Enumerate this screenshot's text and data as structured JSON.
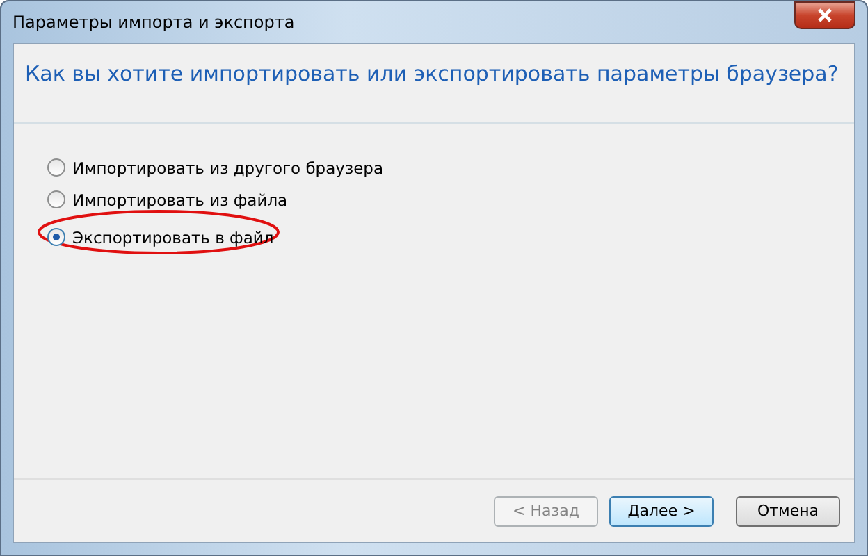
{
  "window": {
    "title": "Параметры импорта и экспорта"
  },
  "heading": "Как вы хотите импортировать или экспортировать параметры браузера?",
  "options": [
    {
      "label": "Импортировать из другого браузера",
      "selected": false,
      "circled": false
    },
    {
      "label": "Импортировать из файла",
      "selected": false,
      "circled": false
    },
    {
      "label": "Экспортировать в файл",
      "selected": true,
      "circled": true
    }
  ],
  "buttons": [
    {
      "label": "< Назад",
      "disabled": true,
      "default": false
    },
    {
      "label": "Далее >",
      "disabled": false,
      "default": true
    },
    {
      "label": "Отмена",
      "disabled": false,
      "default": false
    }
  ]
}
